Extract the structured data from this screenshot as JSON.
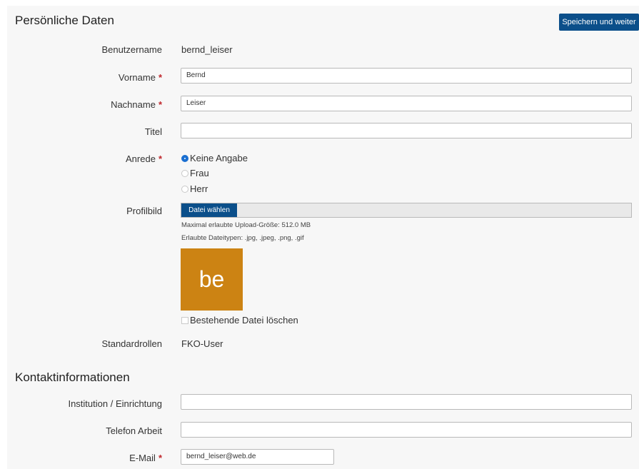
{
  "sections": {
    "personal_title": "Persönliche Daten",
    "contact_title": "Kontaktinformationen"
  },
  "save_button": "Speichern und weiter",
  "fields": {
    "username": {
      "label": "Benutzername",
      "value": "bernd_leiser"
    },
    "firstname": {
      "label": "Vorname",
      "required_mark": "*",
      "value": "Bernd"
    },
    "lastname": {
      "label": "Nachname",
      "required_mark": "*",
      "value": "Leiser"
    },
    "title": {
      "label": "Titel",
      "value": ""
    },
    "salutation": {
      "label": "Anrede",
      "required_mark": "*",
      "options": [
        "Keine Angabe",
        "Frau",
        "Herr"
      ],
      "selected": "Keine Angabe"
    },
    "profile_picture": {
      "label": "Profilbild",
      "button": "Datei wählen",
      "max_size_hint": "Maximal erlaubte Upload-Größe: 512.0 MB",
      "types_hint": "Erlaubte Dateitypen: .jpg, .jpeg, .png, .gif",
      "avatar_text": "be",
      "delete_label": "Bestehende Datei löschen"
    },
    "default_roles": {
      "label": "Standardrollen",
      "value": "FKO-User"
    },
    "institution": {
      "label": "Institution / Einrichtung",
      "value": ""
    },
    "work_phone": {
      "label": "Telefon Arbeit",
      "value": ""
    },
    "email": {
      "label": "E-Mail",
      "required_mark": "*",
      "value": "bernd_leiser@web.de"
    }
  },
  "colors": {
    "primary": "#0b4f8a",
    "required": "#c0282d",
    "avatar_bg": "#cc8313",
    "radio_selected": "#1a6fd1"
  }
}
